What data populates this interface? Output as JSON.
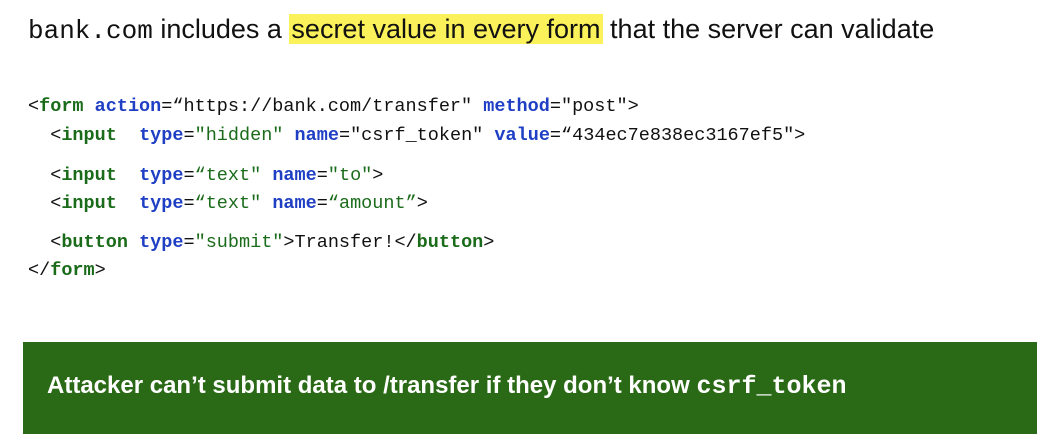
{
  "heading": {
    "domain": "bank.com",
    "text1": " includes a ",
    "highlight": "secret value in every form",
    "text2": " that the server can validate"
  },
  "code": {
    "l1": {
      "open": "<",
      "tag": "form",
      "s1": " ",
      "a1": "action",
      "eq1": "=",
      "v1": "“https://bank.com/transfer\"",
      "s2": " ",
      "a2": "method",
      "eq2": "=",
      "v2": "\"post\"",
      "close": ">"
    },
    "l2": {
      "indent": "  ",
      "open": "<",
      "tag": "input",
      "s1": "  ",
      "a1": "type",
      "eq1": "=",
      "v1": "\"hidden\"",
      "s2": " ",
      "a2": "name",
      "eq2": "=",
      "v2": "\"csrf_token\"",
      "s3": " ",
      "a3": "value",
      "eq3": "=",
      "v3": "“434ec7e838ec3167ef5\"",
      "close": ">"
    },
    "l3": {
      "indent": "  ",
      "open": "<",
      "tag": "input",
      "s1": "  ",
      "a1": "type",
      "eq1": "=",
      "v1": "“text\"",
      "s2": " ",
      "a2": "name",
      "eq2": "=",
      "v2": "\"to\"",
      "close": ">"
    },
    "l4": {
      "indent": "  ",
      "open": "<",
      "tag": "input",
      "s1": "  ",
      "a1": "type",
      "eq1": "=",
      "v1": "“text\"",
      "s2": " ",
      "a2": "name",
      "eq2": "=",
      "v2": "“amount”",
      "close": ">"
    },
    "l5": {
      "indent": "  ",
      "open": "<",
      "tag": "button",
      "s1": " ",
      "a1": "type",
      "eq1": "=",
      "v1": "\"submit\"",
      "mid": ">Transfer!</",
      "tag2": "button",
      "close": ">"
    },
    "l6": {
      "open": "</",
      "tag": "form",
      "close": ">"
    }
  },
  "banner": {
    "text": "Attacker can’t submit data to /transfer if they don’t know ",
    "code": "csrf_token"
  },
  "colors": {
    "highlight": "#fbf15b",
    "banner": "#2a6a16",
    "tag": "#1a6b1a",
    "attribute": "#1f3fc4"
  }
}
